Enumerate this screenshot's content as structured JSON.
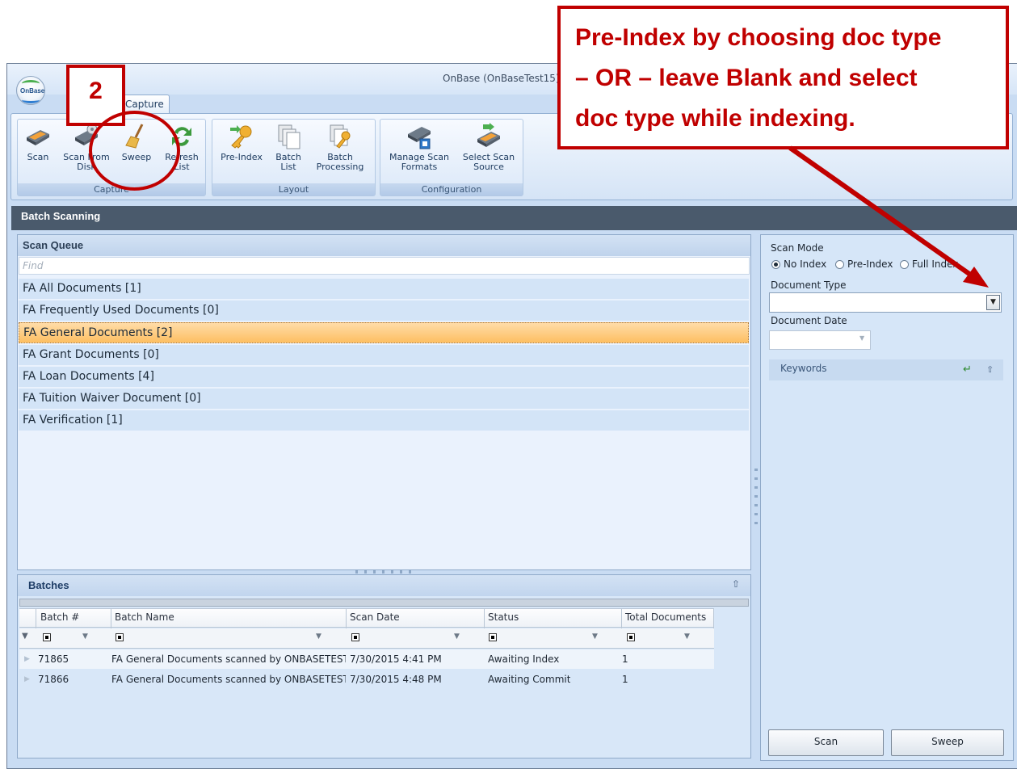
{
  "window": {
    "title": "OnBase (OnBaseTest15)"
  },
  "app_logo": "OnBase",
  "ribbon": {
    "tab": "Capture",
    "groups": {
      "capture": {
        "label": "Capture",
        "buttons": [
          {
            "label": "Scan",
            "icon": "scanner-icon"
          },
          {
            "label": "Scan From Disk",
            "icon": "scan-from-disk-icon"
          },
          {
            "label": "Sweep",
            "icon": "broom-icon"
          },
          {
            "label": "Refresh List",
            "icon": "refresh-icon"
          }
        ]
      },
      "layout": {
        "label": "Layout",
        "buttons": [
          {
            "label": "Pre-Index",
            "icon": "key-icon"
          },
          {
            "label": "Batch List",
            "icon": "pages-icon"
          },
          {
            "label": "Batch Processing",
            "icon": "pages-key-icon"
          }
        ]
      },
      "configuration": {
        "label": "Configuration",
        "buttons": [
          {
            "label": "Manage Scan Formats",
            "icon": "scanner-settings-icon"
          },
          {
            "label": "Select Scan Source",
            "icon": "scanner-source-icon"
          }
        ]
      }
    }
  },
  "batch_scanning": {
    "title": "Batch Scanning"
  },
  "scan_queue": {
    "title": "Scan Queue",
    "find_placeholder": "Find",
    "items": [
      "FA All Documents [1]",
      "FA Frequently Used Documents [0]",
      "FA General Documents [2]",
      "FA Grant Documents [0]",
      "FA Loan Documents [4]",
      "FA Tuition Waiver Document [0]",
      "FA Verification [1]"
    ],
    "selected_index": 2
  },
  "batches": {
    "title": "Batches",
    "columns": [
      "Batch #",
      "Batch Name",
      "Scan Date",
      "Status",
      "Total Documents"
    ],
    "rows": [
      [
        "71865",
        "FA General Documents scanned  by ONBASETEST",
        "7/30/2015 4:41 PM",
        "Awaiting Index",
        "1"
      ],
      [
        "71866",
        "FA General Documents scanned  by ONBASETEST",
        "7/30/2015 4:48 PM",
        "Awaiting Commit",
        "1"
      ]
    ]
  },
  "right_panel": {
    "scan_mode_label": "Scan Mode",
    "modes": [
      "No Index",
      "Pre-Index",
      "Full Index"
    ],
    "selected_mode": "No Index",
    "document_type_label": "Document Type",
    "document_type_value": "",
    "document_date_label": "Document Date",
    "keywords_label": "Keywords",
    "scan_button": "Scan",
    "sweep_button": "Sweep"
  },
  "annotations": {
    "callout_lines": [
      "Pre-Index by choosing doc type",
      "– OR – leave Blank and select",
      "doc type while indexing."
    ],
    "step_number": "2",
    "accent_color": "#c00000"
  }
}
